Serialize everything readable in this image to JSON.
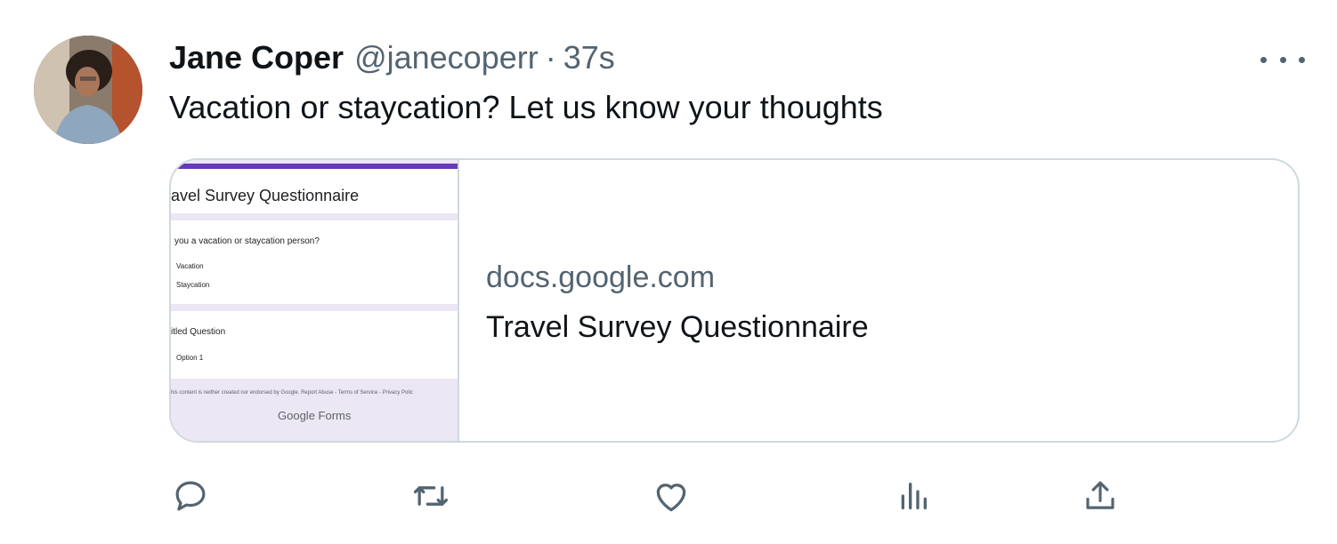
{
  "tweet": {
    "author_name": "Jane Coper",
    "handle": "@janecoperr",
    "separator": "·",
    "time": "37s",
    "text": "Vacation or staycation? Let us know your thoughts"
  },
  "card": {
    "domain": "docs.google.com",
    "title": "Travel Survey Questionnaire",
    "preview": {
      "title": "avel Survey Questionnaire",
      "question": "you a vacation or staycation person?",
      "options": [
        "Vacation",
        "Staycation"
      ],
      "question2": "itled Question",
      "option2": "Option 1",
      "footer": "his content is neither created nor endorsed by Google. Report Abuse - Terms of Service - Privacy Polic",
      "brand": "Google Forms"
    }
  },
  "icons": {
    "more": "more-horizontal-icon",
    "reply": "reply-icon",
    "retweet": "retweet-icon",
    "like": "heart-icon",
    "views": "views-chart-icon",
    "share": "share-icon"
  },
  "colors": {
    "text": "#0f1419",
    "secondary": "#536471",
    "border": "#cfd9de",
    "forms_accent": "#673ab7"
  }
}
